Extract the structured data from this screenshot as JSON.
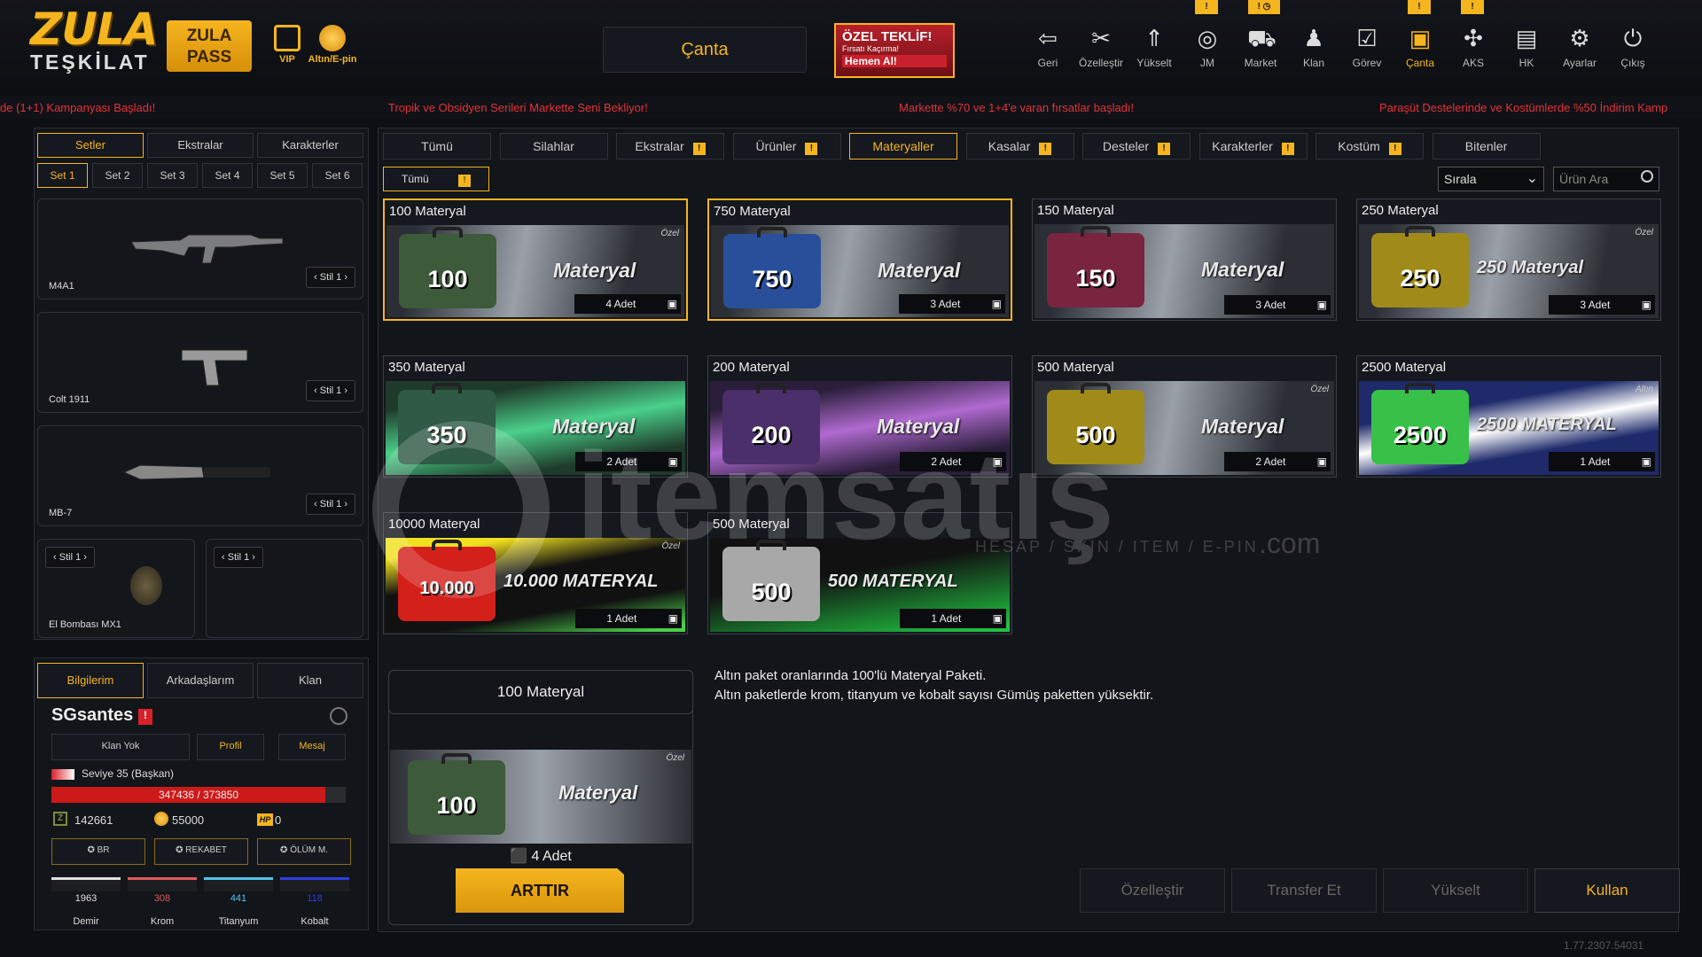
{
  "brand": {
    "logo_line1": "ZULA",
    "logo_line2": "TEŞKİLAT",
    "pass_line1": "ZULA",
    "pass_line2": "PASS"
  },
  "hud": {
    "vip": "VIP",
    "altin": "Altın/E-pin"
  },
  "header": {
    "title": "Çanta"
  },
  "offer": {
    "title": "ÖZEL TEKLİF!",
    "sub": "Fırsatı Kaçırma!",
    "cta": "Hemen Al!"
  },
  "nav": [
    {
      "label": "Geri",
      "icon": "back-icon",
      "glyph": "⇦"
    },
    {
      "label": "Özelleştir",
      "icon": "tools-icon",
      "glyph": "✂"
    },
    {
      "label": "Yükselt",
      "icon": "upgrade-icon",
      "glyph": "⇑"
    },
    {
      "label": "JM",
      "icon": "coins-icon",
      "glyph": "◎"
    },
    {
      "label": "Market",
      "icon": "cart-icon",
      "glyph": "⛟"
    },
    {
      "label": "Klan",
      "icon": "clan-icon",
      "glyph": "♟"
    },
    {
      "label": "Görev",
      "icon": "clipboard-icon",
      "glyph": "☑"
    },
    {
      "label": "Çanta",
      "icon": "bag-icon",
      "glyph": "▣"
    },
    {
      "label": "AKS",
      "icon": "network-icon",
      "glyph": "✣"
    },
    {
      "label": "HK",
      "icon": "wallet-icon",
      "glyph": "▤"
    },
    {
      "label": "Ayarlar",
      "icon": "gear-icon",
      "glyph": "⚙"
    },
    {
      "label": "Çıkış",
      "icon": "power-icon",
      "glyph": "⏻"
    }
  ],
  "ticker": [
    "de (1+1) Kampanyası Başladı!",
    "Tropik ve Obsidyen Serileri Markette Seni Bekliyor!",
    "Markette %70 ve 1+4'e varan fırsatlar başladı!",
    "Paraşüt Destelerinde ve Kostümlerde %50 İndirim Kamp"
  ],
  "left": {
    "tabs": [
      "Setler",
      "Ekstralar",
      "Karakterler"
    ],
    "sets": [
      "Set 1",
      "Set 2",
      "Set 3",
      "Set 4",
      "Set 5",
      "Set 6"
    ],
    "weapons": [
      {
        "name": "M4A1",
        "stil": "Stil 1"
      },
      {
        "name": "Colt 1911",
        "stil": "Stil 1"
      },
      {
        "name": "MB-7",
        "stil": "Stil 1"
      },
      {
        "name": "El Bombası MX1",
        "stil": "Stil 1"
      },
      {
        "name": "",
        "stil": "Stil 1"
      }
    ]
  },
  "profile": {
    "tabs": [
      "Bilgilerim",
      "Arkadaşlarım",
      "Klan"
    ],
    "username": "SGsantes",
    "buttons": [
      "Klan Yok",
      "Profil",
      "Mesaj"
    ],
    "level": "Seviye 35 (Başkan)",
    "xp": "347436 / 373850",
    "xp_progress": 0.93,
    "zp": "142661",
    "gold": "55000",
    "hp": "0",
    "modes": [
      "BR",
      "REKABET",
      "ÖLÜM M."
    ],
    "materials": [
      {
        "value": "1963",
        "label": "Demir",
        "color": "#e0e0e0"
      },
      {
        "value": "308",
        "label": "Krom",
        "color": "#e05a5a"
      },
      {
        "value": "441",
        "label": "Titanyum",
        "color": "#4fc4e8"
      },
      {
        "value": "118",
        "label": "Kobalt",
        "color": "#2a3ee0"
      }
    ]
  },
  "categories": [
    "Tümü",
    "Silahlar",
    "Ekstralar",
    "Ürünler",
    "Materyaller",
    "Kasalar",
    "Desteler",
    "Karakterler",
    "Kostüm",
    "Bitenler"
  ],
  "filter": {
    "sub": "Tümü",
    "sort": "Sırala",
    "search_placeholder": "Ürün Ara"
  },
  "items": [
    {
      "title": "100 Materyal",
      "count": "4 Adet",
      "num": "100",
      "word": "Materyal",
      "tag": "Özel",
      "color": "#3d5a3a"
    },
    {
      "title": "750 Materyal",
      "count": "3 Adet",
      "num": "750",
      "word": "Materyal",
      "tag": "",
      "color": "#2a4f9a"
    },
    {
      "title": "150 Materyal",
      "count": "3 Adet",
      "num": "150",
      "word": "Materyal",
      "tag": "",
      "color": "#7a2540"
    },
    {
      "title": "250 Materyal",
      "count": "3 Adet",
      "num": "250",
      "word": "250 Materyal",
      "tag": "Özel",
      "color": "#a08a1a"
    },
    {
      "title": "350 Materyal",
      "count": "2 Adet",
      "num": "350",
      "word": "Materyal",
      "tag": "",
      "color": "#2f5a45"
    },
    {
      "title": "200 Materyal",
      "count": "2 Adet",
      "num": "200",
      "word": "Materyal",
      "tag": "",
      "color": "#4a2f6a"
    },
    {
      "title": "500 Materyal",
      "count": "2 Adet",
      "num": "500",
      "word": "Materyal",
      "tag": "Özel",
      "color": "#a08a1a"
    },
    {
      "title": "2500 Materyal",
      "count": "1 Adet",
      "num": "2500",
      "word": "2500 MATERYAL",
      "tag": "Altın",
      "color": "#38c048"
    },
    {
      "title": "10000 Materyal",
      "count": "1 Adet",
      "num": "10.000",
      "word": "10.000 MATERYAL",
      "tag": "Özel",
      "color": "#d4201a"
    },
    {
      "title": "500 Materyal",
      "count": "1 Adet",
      "num": "500",
      "word": "500 MATERYAL",
      "tag": "",
      "color": "#a8a8a8"
    }
  ],
  "detail": {
    "title": "100 Materyal",
    "num": "100",
    "word": "Materyal",
    "tag": "Özel",
    "count": "4 Adet",
    "button": "ARTTIR",
    "desc1": "Altın paket oranlarında 100'lü Materyal Paketi.",
    "desc2": "Altın paketlerde krom, titanyum ve kobalt sayısı Gümüş paketten yüksektir."
  },
  "actions": [
    "Özelleştir",
    "Transfer Et",
    "Yükselt",
    "Kullan"
  ],
  "watermark": {
    "name": "itemsatış",
    "tagline": "HESAP / SKIN / ITEM / E-PIN",
    "domain": ".com"
  },
  "version": "1.77.2307.54031",
  "accent": "#f5b51e"
}
